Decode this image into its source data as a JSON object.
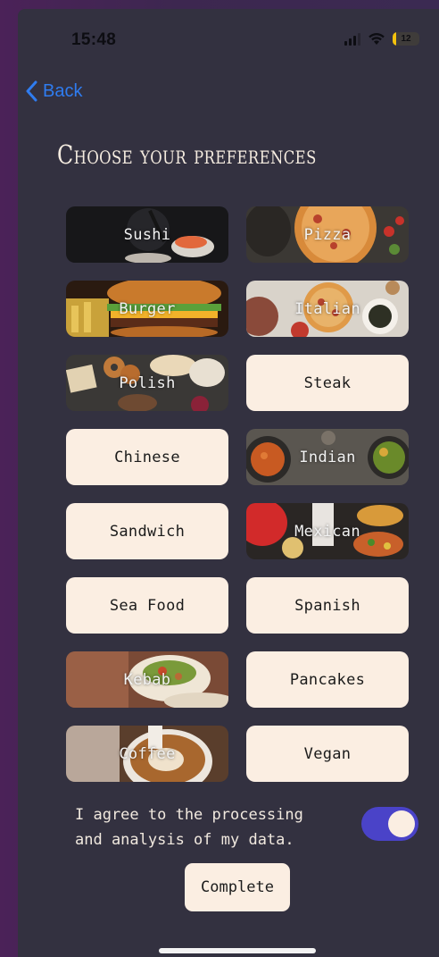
{
  "status_bar": {
    "time": "15:48",
    "battery_level": "12",
    "battery_fraction": 0.12
  },
  "nav": {
    "back_label": "Back"
  },
  "page": {
    "title": "Choose your preferences"
  },
  "preferences": [
    {
      "label": "Sushi",
      "style": "image"
    },
    {
      "label": "Pizza",
      "style": "image"
    },
    {
      "label": "Burger",
      "style": "image"
    },
    {
      "label": "Italian",
      "style": "image"
    },
    {
      "label": "Polish",
      "style": "image"
    },
    {
      "label": "Steak",
      "style": "plain"
    },
    {
      "label": "Chinese",
      "style": "plain"
    },
    {
      "label": "Indian",
      "style": "image"
    },
    {
      "label": "Sandwich",
      "style": "plain"
    },
    {
      "label": "Mexican",
      "style": "image"
    },
    {
      "label": "Sea Food",
      "style": "plain"
    },
    {
      "label": "Spanish",
      "style": "plain"
    },
    {
      "label": "Kebab",
      "style": "image"
    },
    {
      "label": "Pancakes",
      "style": "plain"
    },
    {
      "label": "Coffee",
      "style": "image"
    },
    {
      "label": "Vegan",
      "style": "plain"
    }
  ],
  "consent": {
    "line1": "I agree to the processing",
    "line2": "and analysis of my data.",
    "toggle_on": true
  },
  "actions": {
    "complete_label": "Complete"
  },
  "colors": {
    "background": "#333140",
    "tile": "#fbeee2",
    "accent": "#4a43c8",
    "link": "#2f7cf0"
  }
}
